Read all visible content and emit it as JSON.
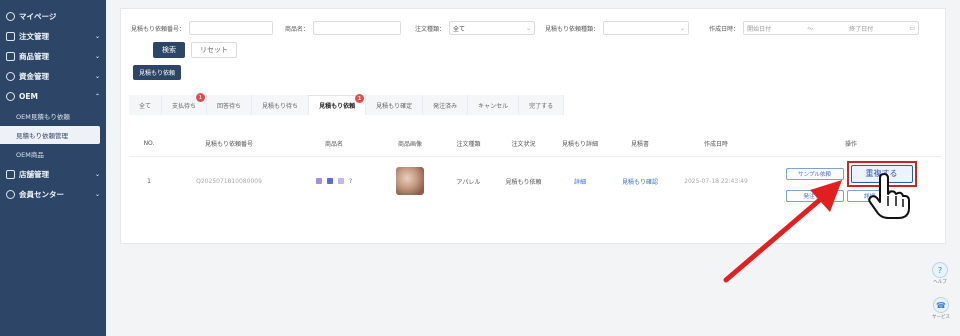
{
  "sidebar": {
    "items": [
      {
        "label": "マイページ"
      },
      {
        "label": "注文管理",
        "chevron": "⌄"
      },
      {
        "label": "商品管理",
        "chevron": "⌄"
      },
      {
        "label": "資金管理",
        "chevron": "⌄"
      },
      {
        "label": "OEM",
        "chevron": "⌃"
      },
      {
        "label": "店舗管理",
        "chevron": "⌄"
      },
      {
        "label": "会員センター",
        "chevron": "⌄"
      }
    ],
    "sub_items": [
      {
        "label": "OEM見積もり依頼"
      },
      {
        "label": "見積もり依頼管理"
      },
      {
        "label": "OEM商品"
      }
    ]
  },
  "filters": {
    "request_no_label": "見積もり依頼番号：",
    "request_no_value": "",
    "product_name_label": "商品名：",
    "product_name_value": "",
    "order_type_label": "注文種類：",
    "order_type_value": "全て",
    "quote_type_label": "見積もり依頼種類：",
    "quote_type_value": "",
    "created_label": "作成日時：",
    "date_from_placeholder": "開始日付",
    "date_sep": "～",
    "date_to_placeholder": "終了日付",
    "search_label": "検索",
    "reset_label": "リセット",
    "export_label": "見積もり依頼"
  },
  "tabs": [
    {
      "label": "全て",
      "badge": ""
    },
    {
      "label": "支払待ち",
      "badge": "1"
    },
    {
      "label": "回答待ち",
      "badge": ""
    },
    {
      "label": "見積もり待ち",
      "badge": ""
    },
    {
      "label": "見積もり依頼",
      "badge": "1"
    },
    {
      "label": "見積もり確定",
      "badge": ""
    },
    {
      "label": "発注済み",
      "badge": ""
    },
    {
      "label": "キャンセル",
      "badge": ""
    },
    {
      "label": "完了する",
      "badge": ""
    }
  ],
  "table": {
    "headers": [
      "NO.",
      "見積もり依頼番号",
      "商品名",
      "商品画像",
      "注文種類",
      "注文状況",
      "見積もり詳細",
      "見積書",
      "作成日時",
      "操作"
    ],
    "row": {
      "no": "1",
      "request_no": "Q2025071810080009",
      "swatch_colors": [
        "#a48fd8",
        "#5a6bd8",
        "#c9b3ee"
      ],
      "swatch_note": "?",
      "order_type": "アパレル",
      "order_status": "見積もり依頼",
      "detail_link": "詳細",
      "quote_link": "見積もり確認",
      "created_at": "2025-07-18 22:43:49",
      "op_sample": "サンプル依頼",
      "op_reorder": "重複する",
      "op_order": "発注する",
      "op_confirm": "詳細"
    }
  },
  "floating": {
    "help_label": "ヘルプ",
    "service_label": "サービス"
  },
  "colors": {
    "sidebar_bg": "#2d4566",
    "accent": "#2d4566",
    "highlight": "#d32020",
    "badge": "#e54b4b"
  }
}
